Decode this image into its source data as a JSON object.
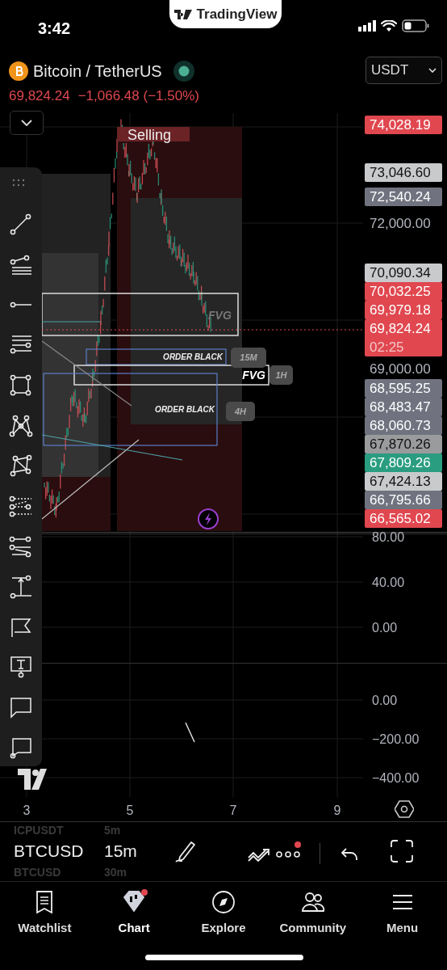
{
  "status_bar": {
    "time": "3:42"
  },
  "app_banner": {
    "title": "TradingView"
  },
  "symbol": {
    "name": "Bitcoin / TetherUS",
    "market_open": true,
    "price": "69,824.24",
    "change": "−1,066.48 (−1.50%)"
  },
  "currency_select": {
    "value": "USDT"
  },
  "chart": {
    "annotations": [
      {
        "kind": "zone-title",
        "text": "Selling"
      },
      {
        "kind": "zone-label",
        "text": "FVG"
      },
      {
        "kind": "box-label",
        "text": "ORDER BLACK",
        "tag": "15M"
      },
      {
        "kind": "box-label-strong",
        "text": "FVG",
        "tag": "1H"
      },
      {
        "kind": "box-label",
        "text": "ORDER BLACK",
        "tag": "4H"
      }
    ],
    "price_labels": [
      {
        "kind": "tag",
        "text": "74,028.19",
        "color": "#e0474f"
      },
      {
        "kind": "tag",
        "text": "73,046.60",
        "color": "#c9cacc"
      },
      {
        "kind": "tag",
        "text": "72,540.24",
        "color": "#70737f"
      },
      {
        "kind": "axis",
        "text": "72,000.00"
      },
      {
        "kind": "tag",
        "text": "70,090.34",
        "color": "#c9cacc"
      },
      {
        "kind": "tag",
        "text": "70,032.25",
        "color": "#e0474f"
      },
      {
        "kind": "tag",
        "text": "69,979.18",
        "color": "#e0474f"
      },
      {
        "kind": "current",
        "text": "69,824.24",
        "countdown": "02:25",
        "color": "#e0474f"
      },
      {
        "kind": "axis",
        "text": "69,000.00"
      },
      {
        "kind": "tag",
        "text": "68,595.25",
        "color": "#70737f"
      },
      {
        "kind": "tag",
        "text": "68,483.47",
        "color": "#70737f"
      },
      {
        "kind": "tag",
        "text": "68,060.73",
        "color": "#70737f"
      },
      {
        "kind": "tag",
        "text": "67,870.26",
        "color": "#9a9b9d"
      },
      {
        "kind": "tag",
        "text": "67,809.26",
        "color": "#2a9d80"
      },
      {
        "kind": "tag",
        "text": "67,424.13",
        "color": "#c9cacc"
      },
      {
        "kind": "tag",
        "text": "66,795.66",
        "color": "#70737f"
      },
      {
        "kind": "tag",
        "text": "66,565.02",
        "color": "#e0474f"
      }
    ]
  },
  "indicator_panes": [
    {
      "ticks": [
        "80.00",
        "40.00",
        "0.00"
      ]
    },
    {
      "ticks": [
        "0.00",
        "−200.00",
        "−400.00"
      ]
    }
  ],
  "time_axis": [
    "3",
    "5",
    "7",
    "9"
  ],
  "symbol_picker": [
    {
      "symbol": "ICPUSDT",
      "interval": "5m",
      "selected": false
    },
    {
      "symbol": "BTCUSD",
      "interval": "15m",
      "selected": true
    },
    {
      "symbol": "BTCUSD",
      "interval": "30m",
      "selected": false
    }
  ],
  "toolbar": {
    "more_alert": true
  },
  "nav": [
    {
      "kind": "watchlist",
      "label": "Watchlist",
      "selected": false,
      "badge": false
    },
    {
      "kind": "chart",
      "label": "Chart",
      "selected": true,
      "badge": true
    },
    {
      "kind": "explore",
      "label": "Explore",
      "selected": false,
      "badge": false
    },
    {
      "kind": "community",
      "label": "Community",
      "selected": false,
      "badge": false
    },
    {
      "kind": "menu",
      "label": "Menu",
      "selected": false,
      "badge": false
    }
  ]
}
